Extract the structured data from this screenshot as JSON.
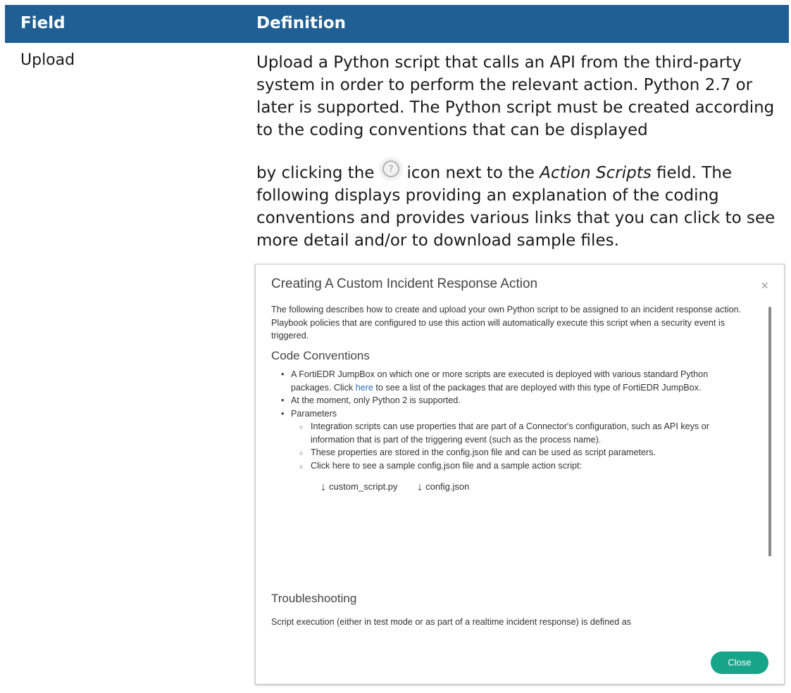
{
  "table": {
    "header": {
      "col1": "Field",
      "col2": "Definition"
    },
    "row": {
      "field": "Upload",
      "definition_p1": "Upload a Python script that calls an API from the third-party system in order to perform the relevant action. Python 2.7 or later is supported. The Python script must be created according to the coding conventions that can be displayed",
      "definition_p2_before_icon": "by clicking the",
      "definition_p2_after_icon": "icon next to the",
      "definition_p2_italic": "Action Scripts",
      "definition_p2_rest": "field. The following displays providing an explanation of the coding conventions and provides various links that you can click to see more detail and/or to download sample files."
    }
  },
  "modal": {
    "title": "Creating A Custom Incident Response Action",
    "close_x": "×",
    "intro": "The following describes how to create and upload your own Python script to be assigned to an incident response action. Playbook policies that are configured to use this action will automatically execute this script when a security event is triggered.",
    "conventions_heading": "Code Conventions",
    "bullet1_before_link": "A FortiEDR JumpBox on which one or more scripts are executed is deployed with various standard Python packages. Click",
    "bullet1_link": "here",
    "bullet1_after_link": "to see a list of the packages that are deployed with this type of FortiEDR JumpBox.",
    "bullet2": "At the moment, only Python 2 is supported.",
    "bullet3": "Parameters",
    "sub1": "Integration scripts can use properties that are part of a Connector's configuration, such as API keys or information that is part of the triggering event (such as the process name).",
    "sub2": "These properties are stored in the config.json file and can be used as script parameters.",
    "sub3": "Click here to see a sample config.json file and a sample action script:",
    "download1": "custom_script.py",
    "download2": "config.json",
    "download_arrow": "↓",
    "troubleshooting_heading": "Troubleshooting",
    "troubleshooting_text": "Script execution (either in test mode or as part of a realtime incident response) is defined as",
    "close_button": "Close"
  }
}
